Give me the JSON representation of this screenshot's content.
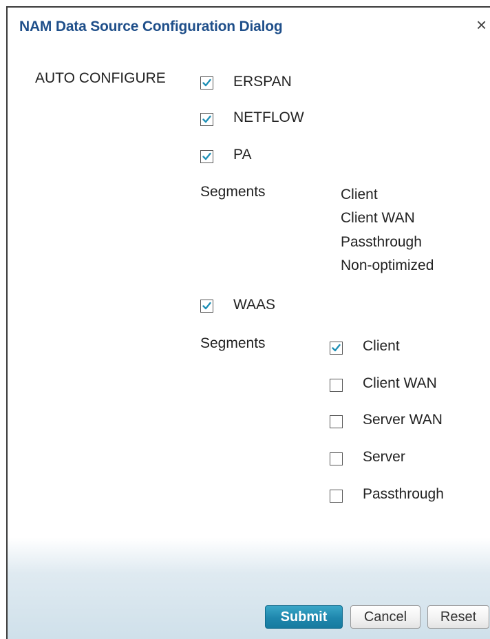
{
  "dialog": {
    "title": "NAM Data Source Configuration Dialog",
    "close_glyph": "×"
  },
  "auto_configure": {
    "label": "AUTO CONFIGURE",
    "options": [
      {
        "label": "ERSPAN",
        "checked": true
      },
      {
        "label": "NETFLOW",
        "checked": true
      },
      {
        "label": "PA",
        "checked": true
      }
    ]
  },
  "pa_segments": {
    "label": "Segments",
    "items": [
      "Client",
      "Client WAN",
      "Passthrough",
      "Non-optimized"
    ]
  },
  "waas": {
    "label": "WAAS",
    "checked": true,
    "segments_label": "Segments",
    "segments": [
      {
        "label": "Client",
        "checked": true
      },
      {
        "label": "Client WAN",
        "checked": false
      },
      {
        "label": "Server WAN",
        "checked": false
      },
      {
        "label": "Server",
        "checked": false
      },
      {
        "label": "Passthrough",
        "checked": false
      }
    ]
  },
  "buttons": {
    "submit": "Submit",
    "cancel": "Cancel",
    "reset": "Reset"
  },
  "colors": {
    "title": "#1f4f8a",
    "checkmark": "#1e8fb5",
    "primary_button": "#1f87ad"
  }
}
